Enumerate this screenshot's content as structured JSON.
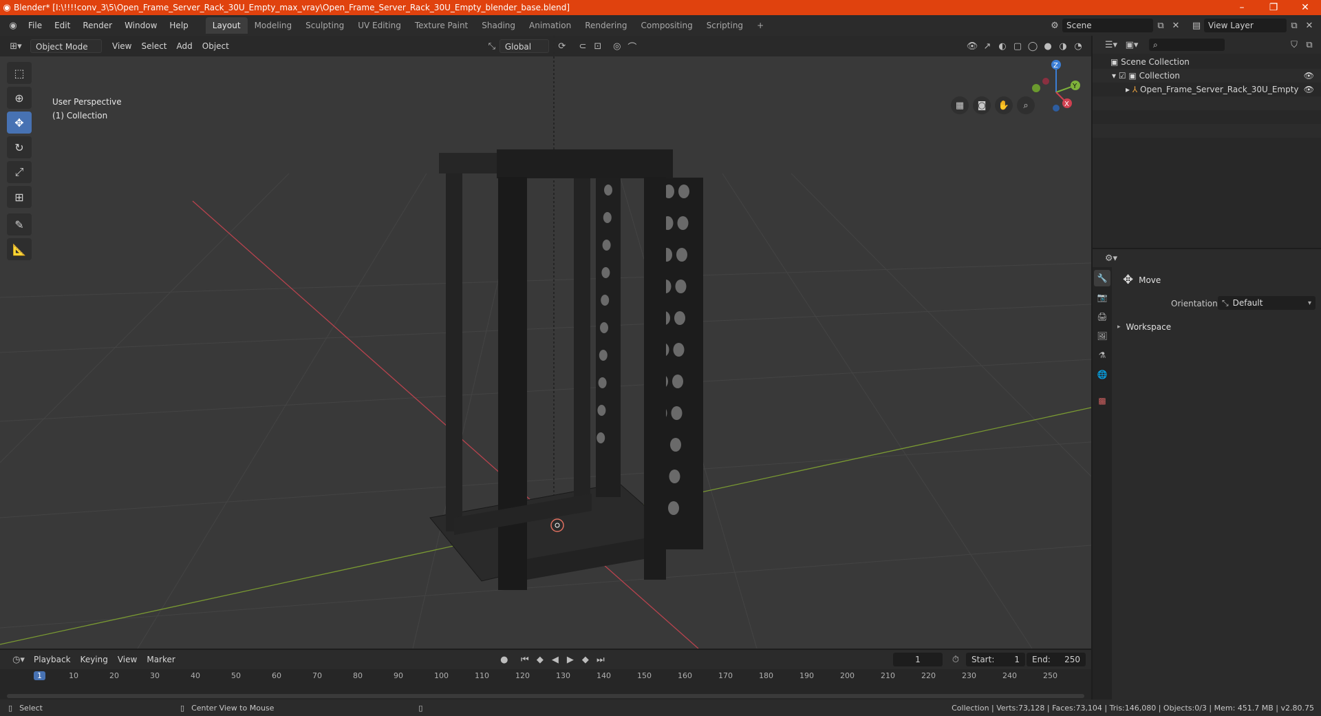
{
  "titlebar": {
    "text": "Blender* [I:\\!!!!conv_3\\5\\Open_Frame_Server_Rack_30U_Empty_max_vray\\Open_Frame_Server_Rack_30U_Empty_blender_base.blend]",
    "minimize": "–",
    "restore": "❐",
    "close": "✕"
  },
  "menu": [
    "File",
    "Edit",
    "Render",
    "Window",
    "Help"
  ],
  "workspaces": [
    "Layout",
    "Modeling",
    "Sculpting",
    "UV Editing",
    "Texture Paint",
    "Shading",
    "Animation",
    "Rendering",
    "Compositing",
    "Scripting"
  ],
  "workspace_add": "+",
  "scene": {
    "value": "Scene",
    "view_layer": "View Layer"
  },
  "viewport_header": {
    "mode": "Object Mode",
    "menus": [
      "View",
      "Select",
      "Add",
      "Object"
    ],
    "orientation": "Global"
  },
  "viewport": {
    "perspective": "User Perspective",
    "collection": "(1) Collection",
    "gizmo": {
      "x": "X",
      "y": "Y",
      "z": "Z"
    }
  },
  "outliner": {
    "scene_collection": "Scene Collection",
    "collection": "Collection",
    "object": "Open_Frame_Server_Rack_30U_Empty"
  },
  "properties": {
    "tool_name": "Move",
    "orientation_label": "Orientation",
    "orientation_value": "Default",
    "workspace": "Workspace"
  },
  "timeline": {
    "menus": [
      "Playback",
      "Keying",
      "View",
      "Marker"
    ],
    "current_frame": "1",
    "start_label": "Start:",
    "start": "1",
    "end_label": "End:",
    "end": "250",
    "ticks": [
      "1",
      "10",
      "20",
      "30",
      "40",
      "50",
      "60",
      "70",
      "80",
      "90",
      "100",
      "110",
      "120",
      "130",
      "140",
      "150",
      "160",
      "170",
      "180",
      "190",
      "200",
      "210",
      "220",
      "230",
      "240",
      "250"
    ]
  },
  "statusbar": {
    "select": "Select",
    "center_view": "Center View to Mouse",
    "stats": "Collection | Verts:73,128 | Faces:73,104 | Tris:146,080 | Objects:0/3 | Mem: 451.7 MB | v2.80.75"
  },
  "colors": {
    "accent": "#4772b3",
    "title": "#e0420e",
    "x_axis": "#d04050",
    "y_axis": "#7eb23a",
    "z_axis": "#3b7ed6"
  }
}
